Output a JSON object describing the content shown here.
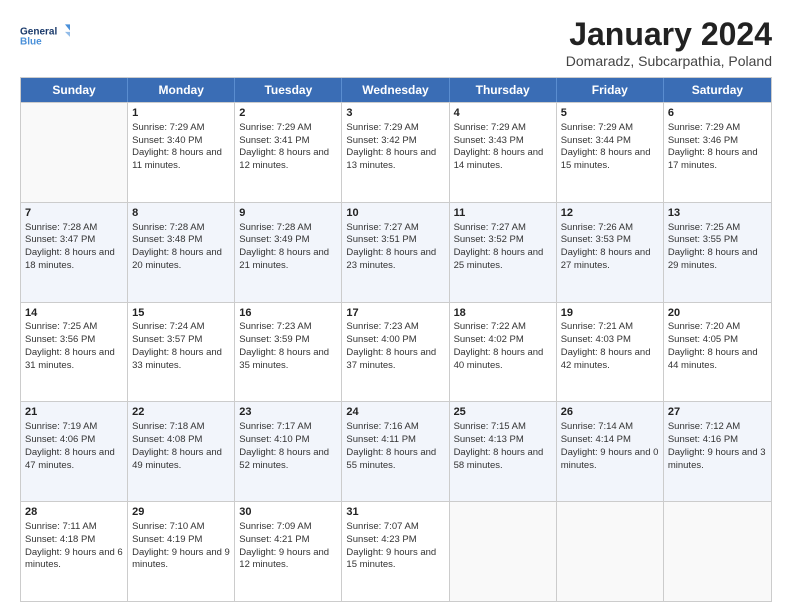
{
  "header": {
    "logo_line1": "General",
    "logo_line2": "Blue",
    "title": "January 2024",
    "subtitle": "Domaradz, Subcarpathia, Poland"
  },
  "calendar": {
    "days_of_week": [
      "Sunday",
      "Monday",
      "Tuesday",
      "Wednesday",
      "Thursday",
      "Friday",
      "Saturday"
    ],
    "rows": [
      [
        {
          "day": "",
          "sunrise": "",
          "sunset": "",
          "daylight": "",
          "empty": true
        },
        {
          "day": "1",
          "sunrise": "Sunrise: 7:29 AM",
          "sunset": "Sunset: 3:40 PM",
          "daylight": "Daylight: 8 hours and 11 minutes."
        },
        {
          "day": "2",
          "sunrise": "Sunrise: 7:29 AM",
          "sunset": "Sunset: 3:41 PM",
          "daylight": "Daylight: 8 hours and 12 minutes."
        },
        {
          "day": "3",
          "sunrise": "Sunrise: 7:29 AM",
          "sunset": "Sunset: 3:42 PM",
          "daylight": "Daylight: 8 hours and 13 minutes."
        },
        {
          "day": "4",
          "sunrise": "Sunrise: 7:29 AM",
          "sunset": "Sunset: 3:43 PM",
          "daylight": "Daylight: 8 hours and 14 minutes."
        },
        {
          "day": "5",
          "sunrise": "Sunrise: 7:29 AM",
          "sunset": "Sunset: 3:44 PM",
          "daylight": "Daylight: 8 hours and 15 minutes."
        },
        {
          "day": "6",
          "sunrise": "Sunrise: 7:29 AM",
          "sunset": "Sunset: 3:46 PM",
          "daylight": "Daylight: 8 hours and 17 minutes."
        }
      ],
      [
        {
          "day": "7",
          "sunrise": "Sunrise: 7:28 AM",
          "sunset": "Sunset: 3:47 PM",
          "daylight": "Daylight: 8 hours and 18 minutes."
        },
        {
          "day": "8",
          "sunrise": "Sunrise: 7:28 AM",
          "sunset": "Sunset: 3:48 PM",
          "daylight": "Daylight: 8 hours and 20 minutes."
        },
        {
          "day": "9",
          "sunrise": "Sunrise: 7:28 AM",
          "sunset": "Sunset: 3:49 PM",
          "daylight": "Daylight: 8 hours and 21 minutes."
        },
        {
          "day": "10",
          "sunrise": "Sunrise: 7:27 AM",
          "sunset": "Sunset: 3:51 PM",
          "daylight": "Daylight: 8 hours and 23 minutes."
        },
        {
          "day": "11",
          "sunrise": "Sunrise: 7:27 AM",
          "sunset": "Sunset: 3:52 PM",
          "daylight": "Daylight: 8 hours and 25 minutes."
        },
        {
          "day": "12",
          "sunrise": "Sunrise: 7:26 AM",
          "sunset": "Sunset: 3:53 PM",
          "daylight": "Daylight: 8 hours and 27 minutes."
        },
        {
          "day": "13",
          "sunrise": "Sunrise: 7:25 AM",
          "sunset": "Sunset: 3:55 PM",
          "daylight": "Daylight: 8 hours and 29 minutes."
        }
      ],
      [
        {
          "day": "14",
          "sunrise": "Sunrise: 7:25 AM",
          "sunset": "Sunset: 3:56 PM",
          "daylight": "Daylight: 8 hours and 31 minutes."
        },
        {
          "day": "15",
          "sunrise": "Sunrise: 7:24 AM",
          "sunset": "Sunset: 3:57 PM",
          "daylight": "Daylight: 8 hours and 33 minutes."
        },
        {
          "day": "16",
          "sunrise": "Sunrise: 7:23 AM",
          "sunset": "Sunset: 3:59 PM",
          "daylight": "Daylight: 8 hours and 35 minutes."
        },
        {
          "day": "17",
          "sunrise": "Sunrise: 7:23 AM",
          "sunset": "Sunset: 4:00 PM",
          "daylight": "Daylight: 8 hours and 37 minutes."
        },
        {
          "day": "18",
          "sunrise": "Sunrise: 7:22 AM",
          "sunset": "Sunset: 4:02 PM",
          "daylight": "Daylight: 8 hours and 40 minutes."
        },
        {
          "day": "19",
          "sunrise": "Sunrise: 7:21 AM",
          "sunset": "Sunset: 4:03 PM",
          "daylight": "Daylight: 8 hours and 42 minutes."
        },
        {
          "day": "20",
          "sunrise": "Sunrise: 7:20 AM",
          "sunset": "Sunset: 4:05 PM",
          "daylight": "Daylight: 8 hours and 44 minutes."
        }
      ],
      [
        {
          "day": "21",
          "sunrise": "Sunrise: 7:19 AM",
          "sunset": "Sunset: 4:06 PM",
          "daylight": "Daylight: 8 hours and 47 minutes."
        },
        {
          "day": "22",
          "sunrise": "Sunrise: 7:18 AM",
          "sunset": "Sunset: 4:08 PM",
          "daylight": "Daylight: 8 hours and 49 minutes."
        },
        {
          "day": "23",
          "sunrise": "Sunrise: 7:17 AM",
          "sunset": "Sunset: 4:10 PM",
          "daylight": "Daylight: 8 hours and 52 minutes."
        },
        {
          "day": "24",
          "sunrise": "Sunrise: 7:16 AM",
          "sunset": "Sunset: 4:11 PM",
          "daylight": "Daylight: 8 hours and 55 minutes."
        },
        {
          "day": "25",
          "sunrise": "Sunrise: 7:15 AM",
          "sunset": "Sunset: 4:13 PM",
          "daylight": "Daylight: 8 hours and 58 minutes."
        },
        {
          "day": "26",
          "sunrise": "Sunrise: 7:14 AM",
          "sunset": "Sunset: 4:14 PM",
          "daylight": "Daylight: 9 hours and 0 minutes."
        },
        {
          "day": "27",
          "sunrise": "Sunrise: 7:12 AM",
          "sunset": "Sunset: 4:16 PM",
          "daylight": "Daylight: 9 hours and 3 minutes."
        }
      ],
      [
        {
          "day": "28",
          "sunrise": "Sunrise: 7:11 AM",
          "sunset": "Sunset: 4:18 PM",
          "daylight": "Daylight: 9 hours and 6 minutes."
        },
        {
          "day": "29",
          "sunrise": "Sunrise: 7:10 AM",
          "sunset": "Sunset: 4:19 PM",
          "daylight": "Daylight: 9 hours and 9 minutes."
        },
        {
          "day": "30",
          "sunrise": "Sunrise: 7:09 AM",
          "sunset": "Sunset: 4:21 PM",
          "daylight": "Daylight: 9 hours and 12 minutes."
        },
        {
          "day": "31",
          "sunrise": "Sunrise: 7:07 AM",
          "sunset": "Sunset: 4:23 PM",
          "daylight": "Daylight: 9 hours and 15 minutes."
        },
        {
          "day": "",
          "sunrise": "",
          "sunset": "",
          "daylight": "",
          "empty": true
        },
        {
          "day": "",
          "sunrise": "",
          "sunset": "",
          "daylight": "",
          "empty": true
        },
        {
          "day": "",
          "sunrise": "",
          "sunset": "",
          "daylight": "",
          "empty": true
        }
      ]
    ]
  }
}
